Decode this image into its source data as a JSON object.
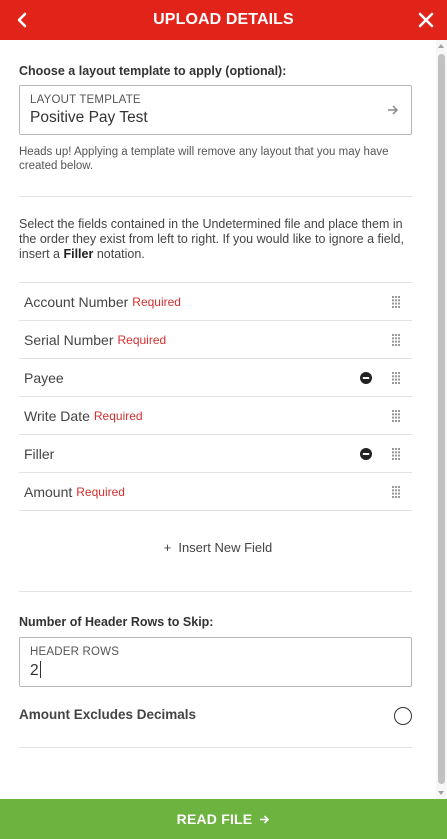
{
  "header": {
    "title": "UPLOAD DETAILS",
    "back_icon": "chevron-left-icon",
    "close_icon": "close-icon",
    "color": "#e2231a"
  },
  "template_section": {
    "label": "Choose a layout template to apply (optional):",
    "field_label": "LAYOUT TEMPLATE",
    "field_value": "Positive Pay Test",
    "arrow_icon": "arrow-right-icon",
    "note": "Heads up! Applying a template will remove any layout that you may have created below."
  },
  "instructions": {
    "text_before": "Select the fields contained in the Undetermined file and place them in the order they exist from left to right. If you would like to ignore a field, insert a ",
    "bold": "Filler",
    "text_after": " notation."
  },
  "fields": [
    {
      "name": "Account Number",
      "required_label": "Required",
      "removable": false
    },
    {
      "name": "Serial Number",
      "required_label": "Required",
      "removable": false
    },
    {
      "name": "Payee",
      "required_label": "",
      "removable": true
    },
    {
      "name": "Write Date",
      "required_label": "Required",
      "removable": false
    },
    {
      "name": "Filler",
      "required_label": "",
      "removable": true
    },
    {
      "name": "Amount",
      "required_label": "Required",
      "removable": false
    }
  ],
  "insert_field": {
    "plus": "+",
    "label": "Insert New Field"
  },
  "header_rows_section": {
    "label": "Number of Header Rows to Skip:",
    "field_label": "HEADER ROWS",
    "field_value": "2"
  },
  "amount_decimals": {
    "label": "Amount Excludes Decimals",
    "checked": false
  },
  "footer": {
    "button_label": "READ FILE",
    "arrow_icon": "arrow-right-icon",
    "color": "#6cb33f"
  },
  "colors": {
    "required": "#d32f2f",
    "divider": "#e2e2e2"
  }
}
